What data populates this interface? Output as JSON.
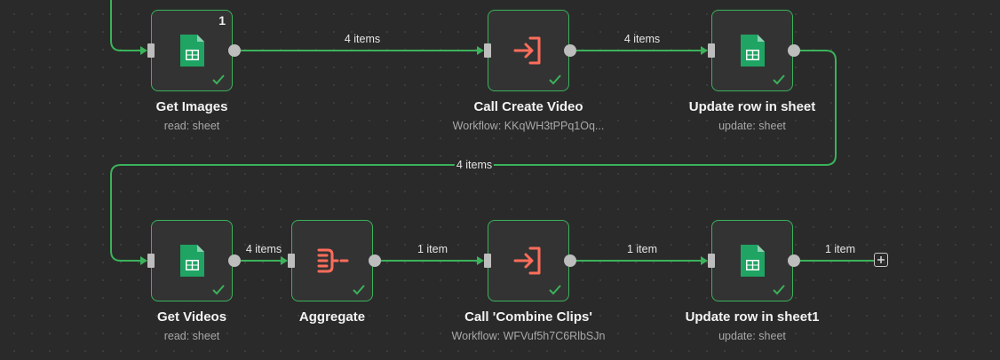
{
  "canvas": {
    "nodes": [
      {
        "id": "get-images",
        "title": "Get Images",
        "subtitle": "read: sheet",
        "icon": "google-sheets-icon",
        "badge": "1",
        "status": "success"
      },
      {
        "id": "call-create-video",
        "title": "Call Create Video",
        "subtitle": "Workflow: KKqWH3tPPq1Oq...",
        "icon": "execute-workflow-icon",
        "status": "success"
      },
      {
        "id": "update-row-in-sheet",
        "title": "Update row in sheet",
        "subtitle": "update: sheet",
        "icon": "google-sheets-icon",
        "status": "success"
      },
      {
        "id": "get-videos",
        "title": "Get Videos",
        "subtitle": "read: sheet",
        "icon": "google-sheets-icon",
        "status": "success"
      },
      {
        "id": "aggregate",
        "title": "Aggregate",
        "subtitle": "",
        "icon": "aggregate-icon",
        "status": "success"
      },
      {
        "id": "call-combine-clips",
        "title": "Call 'Combine Clips'",
        "subtitle": "Workflow: WFVuf5h7C6RlbSJn",
        "icon": "execute-workflow-icon",
        "status": "success"
      },
      {
        "id": "update-row-in-sheet1",
        "title": "Update row in sheet1",
        "subtitle": "update: sheet",
        "icon": "google-sheets-icon",
        "status": "success"
      }
    ],
    "edges": [
      {
        "from": "get-images",
        "to": "call-create-video",
        "label": "4 items"
      },
      {
        "from": "call-create-video",
        "to": "update-row-in-sheet",
        "label": "4 items"
      },
      {
        "from": "update-row-in-sheet",
        "to": "get-videos",
        "label": "4 items"
      },
      {
        "from": "get-videos",
        "to": "aggregate",
        "label": "4 items"
      },
      {
        "from": "aggregate",
        "to": "call-combine-clips",
        "label": "1 item"
      },
      {
        "from": "call-combine-clips",
        "to": "update-row-in-sheet1",
        "label": "1 item"
      },
      {
        "from": "update-row-in-sheet1",
        "to": "add-node",
        "label": "1 item"
      }
    ],
    "colors": {
      "connection": "#3bb25a",
      "sheets_green": "#1fa463",
      "workflow_orange": "#ff6d5a",
      "node_bg": "#333334",
      "canvas_bg": "#2a2a2a"
    }
  }
}
